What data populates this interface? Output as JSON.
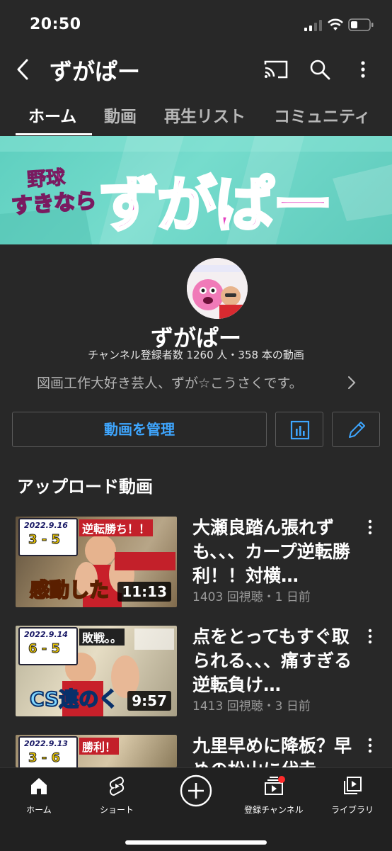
{
  "status_bar": {
    "time": "20:50"
  },
  "header": {
    "title": "ずがぱー"
  },
  "tabs": [
    {
      "label": "ホーム",
      "active": true
    },
    {
      "label": "動画",
      "active": false
    },
    {
      "label": "再生リスト",
      "active": false
    },
    {
      "label": "コミュニティ",
      "active": false
    }
  ],
  "banner": {
    "line1": "野球",
    "line2": "すきなら",
    "main": "ずがぱー"
  },
  "channel": {
    "name": "ずがぱー",
    "meta": "チャンネル登録者数 1260 人・358 本の動画",
    "description": "図画工作大好き芸人、ずが☆こうさくです。"
  },
  "actions": {
    "manage_label": "動画を管理"
  },
  "section": {
    "title": "アップロード動画"
  },
  "videos": [
    {
      "title": "大瀬良踏ん張れずも、、、カープ逆転勝利！！対横…",
      "meta": "1403 回視聴・1 日前",
      "duration": "11:13",
      "thumb_date": "2022.9.16",
      "thumb_score": "3 - 5",
      "thumb_banner": "逆転勝ち！！",
      "thumb_caption": "感動した"
    },
    {
      "title": "点をとってもすぐ取られる、、、痛すぎる逆転負け…",
      "meta": "1413 回視聴・3 日前",
      "duration": "9:57",
      "thumb_date": "2022.9.14",
      "thumb_score": "6 - 5",
      "thumb_banner": "敗戦。。",
      "thumb_caption": "CS遠のく"
    },
    {
      "title": "九里早めに降板？早めの松山に代走",
      "meta": "",
      "duration": "",
      "thumb_date": "2022.9.13",
      "thumb_score": "3 - 6",
      "thumb_banner": "勝利！",
      "thumb_caption": ""
    }
  ],
  "bottom_nav": [
    {
      "label": "ホーム",
      "icon": "home-icon"
    },
    {
      "label": "ショート",
      "icon": "shorts-icon"
    },
    {
      "label": "",
      "icon": "create-icon"
    },
    {
      "label": "登録チャンネル",
      "icon": "subscriptions-icon"
    },
    {
      "label": "ライブラリ",
      "icon": "library-icon"
    }
  ],
  "colors": {
    "accent": "#3ea6ff",
    "background": "#282828",
    "banner_pink": "#e43fc0",
    "banner_teal": "#6dd6c7"
  }
}
